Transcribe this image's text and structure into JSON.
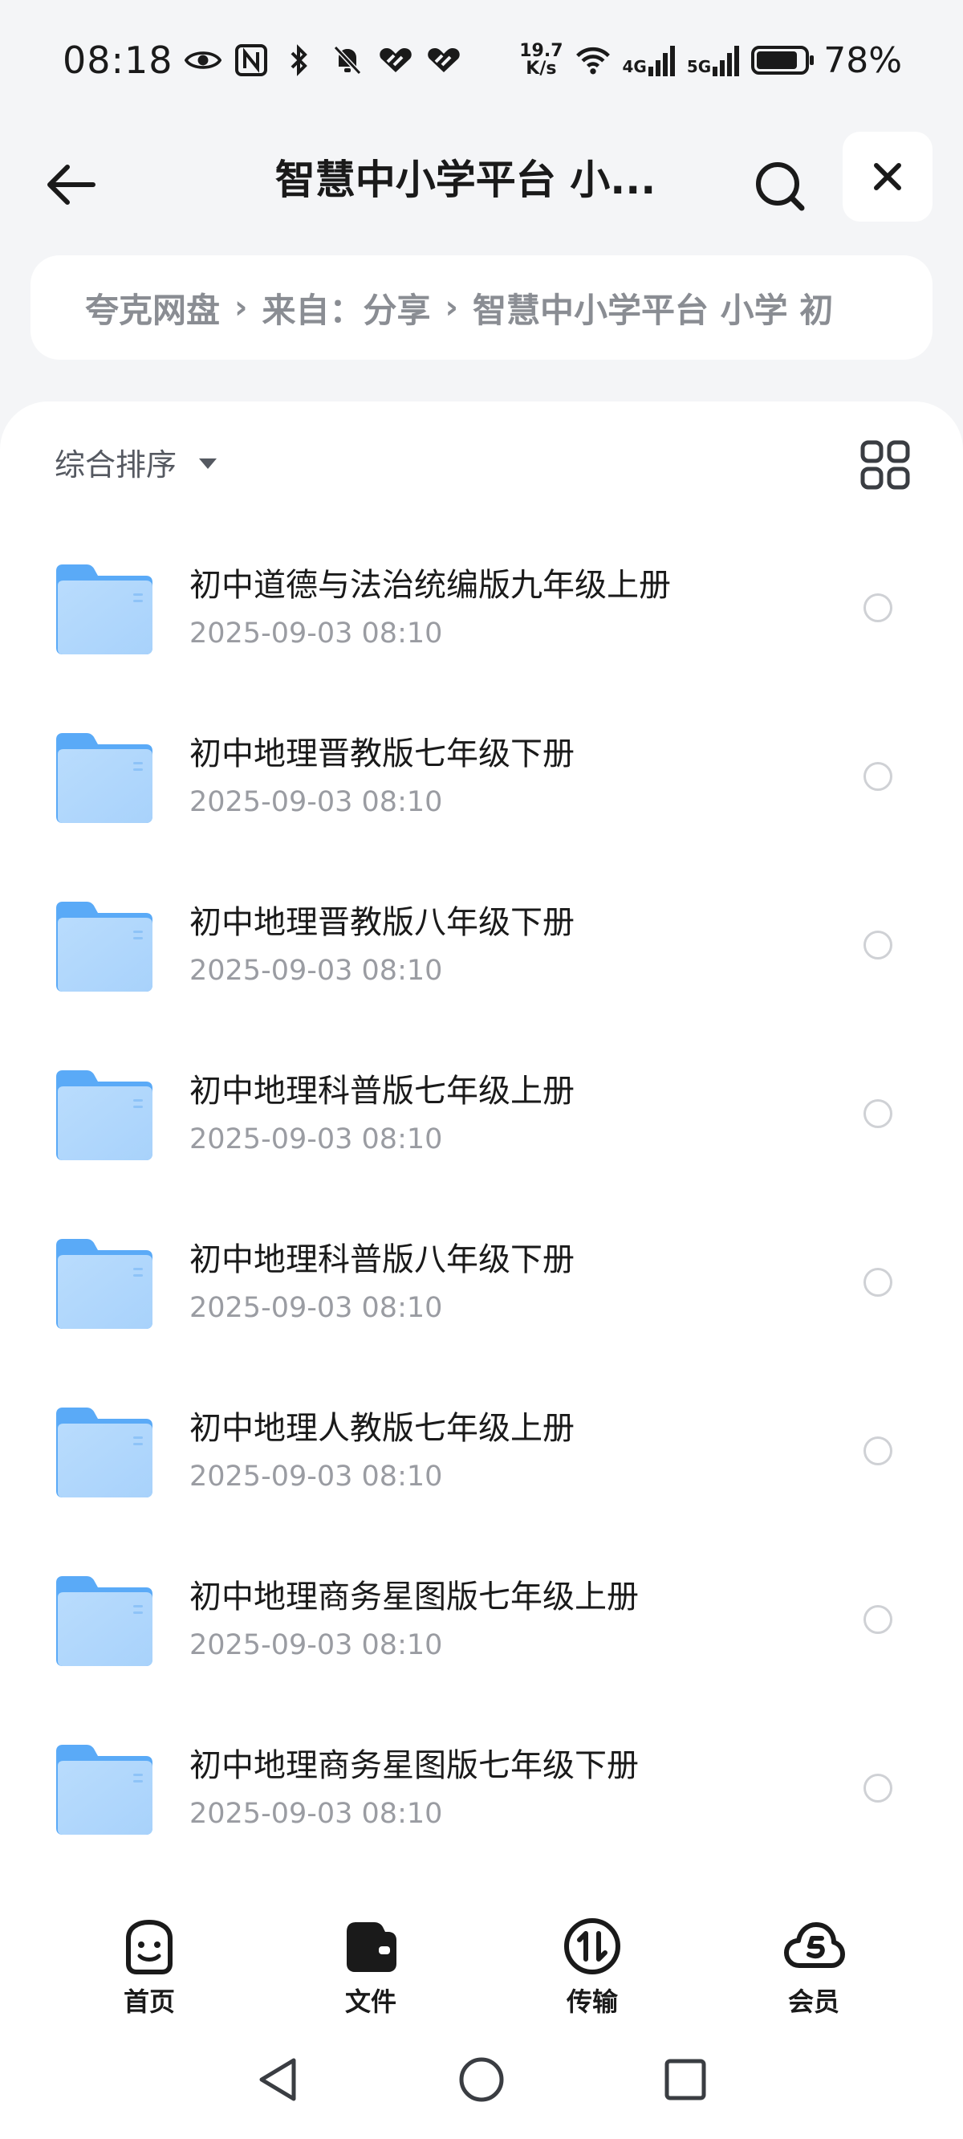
{
  "status_bar": {
    "time": "08:18",
    "net_speed_value": "19.7",
    "net_speed_unit": "K/s",
    "network_4g": "4G",
    "network_5g": "5G",
    "battery_percent": "78%"
  },
  "header": {
    "title": "智慧中小学平台 小..."
  },
  "breadcrumb": {
    "items": [
      "夸克网盘",
      "来自：分享",
      "智慧中小学平台 小学 初"
    ]
  },
  "toolbar": {
    "sort_label": "综合排序"
  },
  "files": [
    {
      "name": "初中道德与法治统编版九年级上册",
      "date": "2025-09-03 08:10"
    },
    {
      "name": "初中地理晋教版七年级下册",
      "date": "2025-09-03 08:10"
    },
    {
      "name": "初中地理晋教版八年级下册",
      "date": "2025-09-03 08:10"
    },
    {
      "name": "初中地理科普版七年级上册",
      "date": "2025-09-03 08:10"
    },
    {
      "name": "初中地理科普版八年级下册",
      "date": "2025-09-03 08:10"
    },
    {
      "name": "初中地理人教版七年级上册",
      "date": "2025-09-03 08:10"
    },
    {
      "name": "初中地理商务星图版七年级上册",
      "date": "2025-09-03 08:10"
    },
    {
      "name": "初中地理商务星图版七年级下册",
      "date": "2025-09-03 08:10"
    }
  ],
  "tabs": [
    {
      "label": "首页",
      "icon": "smiley-home-icon"
    },
    {
      "label": "文件",
      "icon": "wallet-file-icon"
    },
    {
      "label": "传输",
      "icon": "transfer-icon"
    },
    {
      "label": "会员",
      "icon": "cloud-member-icon"
    }
  ],
  "colors": {
    "folder_light": "#b9dcfd",
    "folder_dark": "#5aaaf7",
    "background": "#f4f5f7",
    "text_secondary": "#9a9ca2"
  }
}
